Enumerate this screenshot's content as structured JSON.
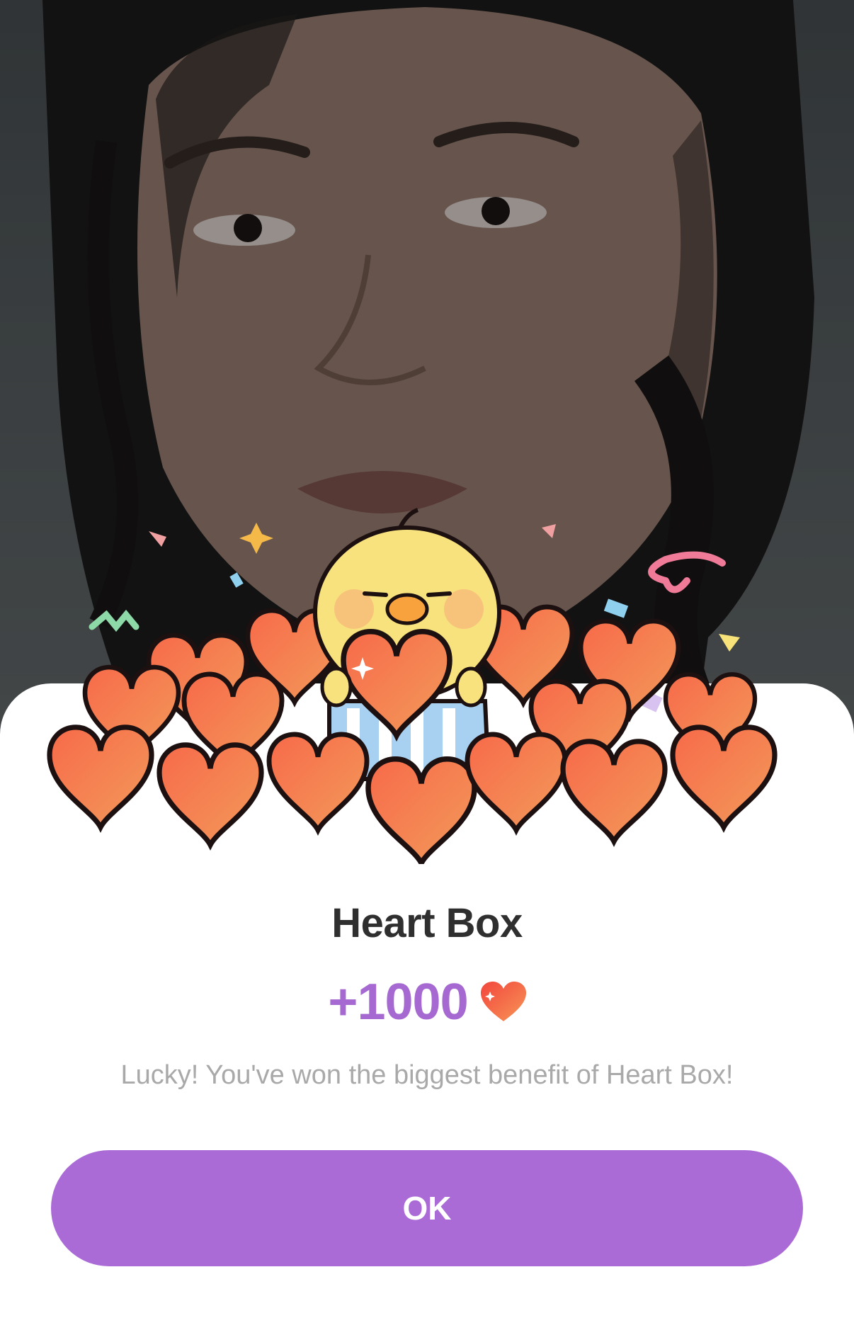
{
  "reward": {
    "title": "Heart Box",
    "amount": "+1000",
    "message": "Lucky! You've won the biggest benefit of Heart Box!",
    "currency_icon": "heart-icon"
  },
  "actions": {
    "ok_label": "OK"
  },
  "colors": {
    "accent": "#aa6bd6",
    "amount_text": "#a569d1",
    "title_text": "#2f2f2f",
    "message_text": "#a9a9a9",
    "heart": "#f0523e"
  }
}
